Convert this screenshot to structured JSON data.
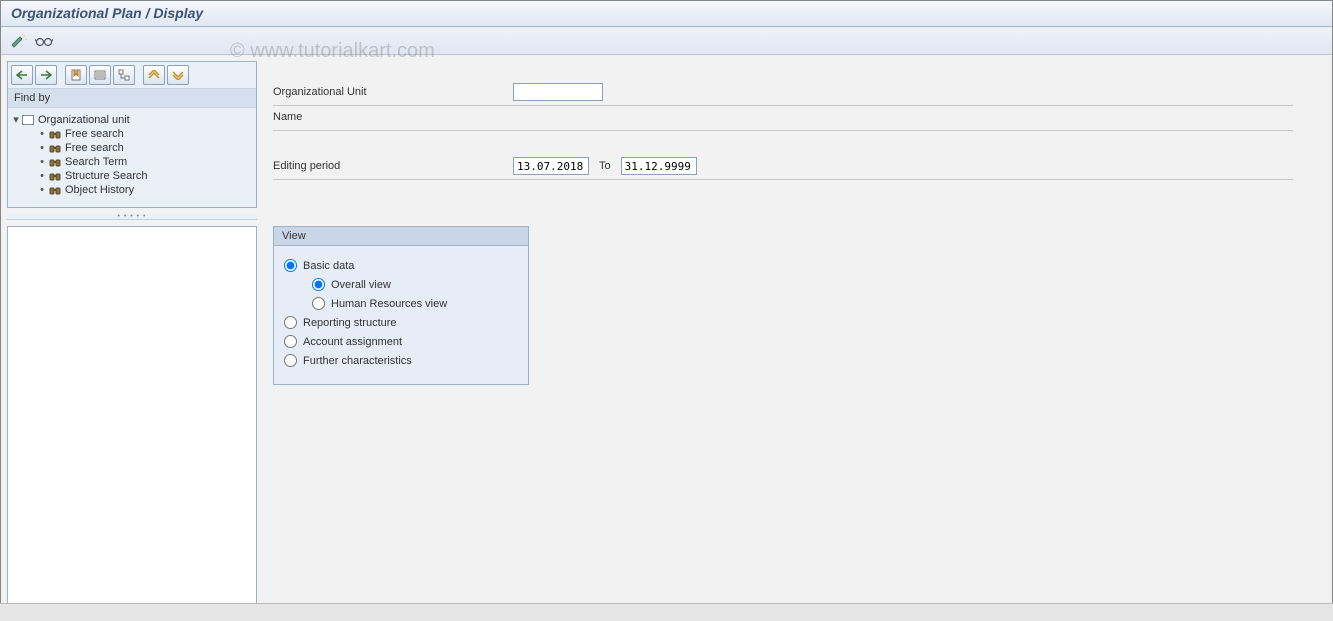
{
  "title": "Organizational Plan / Display",
  "watermark": "© www.tutorialkart.com",
  "sidebar": {
    "findby_label": "Find by",
    "root_label": "Organizational unit",
    "items": [
      {
        "label": "Free search"
      },
      {
        "label": "Free search"
      },
      {
        "label": "Search Term"
      },
      {
        "label": "Structure Search"
      },
      {
        "label": "Object History"
      }
    ]
  },
  "form": {
    "org_unit_label": "Organizational Unit",
    "org_unit_value": "",
    "name_label": "Name",
    "editing_period_label": "Editing period",
    "date_from": "13.07.2018",
    "to_label": "To",
    "date_to": "31.12.9999"
  },
  "view_group": {
    "title": "View",
    "options": {
      "basic_data": "Basic data",
      "overall_view": "Overall view",
      "hr_view": "Human Resources view",
      "reporting": "Reporting structure",
      "account": "Account assignment",
      "further": "Further characteristics"
    }
  }
}
